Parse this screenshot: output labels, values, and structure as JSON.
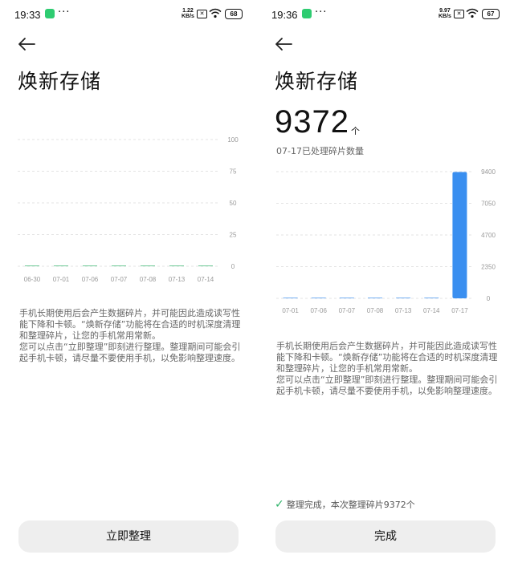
{
  "left": {
    "status": {
      "time": "19:33",
      "speed_top": "1.22",
      "speed_bottom": "KB/s",
      "battery": "68"
    },
    "title": "焕新存储",
    "chart": {
      "y_ticks": [
        "100",
        "75",
        "50",
        "25",
        "0"
      ],
      "x_labels": [
        "06-30",
        "07-01",
        "07-06",
        "07-07",
        "07-08",
        "07-13",
        "07-14"
      ]
    },
    "description": [
      "手机长期使用后会产生数据碎片，并可能因此造成读写性能下降和卡顿。“焕新存储”功能将在合适的时机深度清理和整理碎片，让您的手机常用常新。",
      "您可以点击“立即整理”即刻进行整理。整理期间可能会引起手机卡顿，请尽量不要使用手机，以免影响整理速度。"
    ],
    "button_label": "立即整理"
  },
  "right": {
    "status": {
      "time": "19:36",
      "speed_top": "9.97",
      "speed_bottom": "KB/s",
      "battery": "67"
    },
    "title": "焕新存储",
    "count": "9372",
    "count_unit": "个",
    "count_caption": "07-17已处理碎片数量",
    "chart": {
      "y_ticks": [
        "9400",
        "7050",
        "4700",
        "2350",
        "0"
      ],
      "x_labels": [
        "07-01",
        "07-06",
        "07-07",
        "07-08",
        "07-13",
        "07-14",
        "07-17"
      ]
    },
    "description": [
      "手机长期使用后会产生数据碎片，并可能因此造成读写性能下降和卡顿。“焕新存储”功能将在合适的时机深度清理和整理碎片，让您的手机常用常新。",
      "您可以点击“立即整理”即刻进行整理。整理期间可能会引起手机卡顿，请尽量不要使用手机，以免影响整理速度。"
    ],
    "done_message": "整理完成，本次整理碎片9372个",
    "button_label": "完成"
  },
  "chart_data": [
    {
      "type": "bar",
      "categories": [
        "06-30",
        "07-01",
        "07-06",
        "07-07",
        "07-08",
        "07-13",
        "07-14"
      ],
      "values": [
        0,
        0,
        0,
        0,
        0,
        0,
        0
      ],
      "ylim": [
        0,
        100
      ],
      "yticks": [
        0,
        25,
        50,
        75,
        100
      ],
      "grid": true,
      "bar_color": "#2fb36a"
    },
    {
      "type": "bar",
      "categories": [
        "07-01",
        "07-06",
        "07-07",
        "07-08",
        "07-13",
        "07-14",
        "07-17"
      ],
      "values": [
        0,
        0,
        0,
        0,
        0,
        0,
        9372
      ],
      "ylim": [
        0,
        9400
      ],
      "yticks": [
        0,
        2350,
        4700,
        7050,
        9400
      ],
      "grid": true,
      "bar_color": "#3a8ff0"
    }
  ],
  "colors": {
    "accent_blue": "#3a8ff0",
    "accent_green": "#2fb36a",
    "button_bg": "#eeeeee"
  }
}
